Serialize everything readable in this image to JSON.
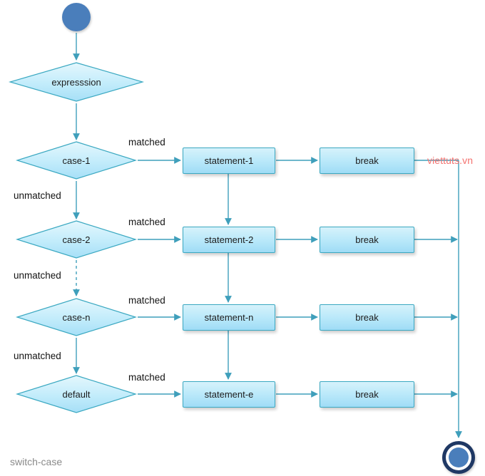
{
  "diagram": {
    "caption": "switch-case",
    "watermark": "viettuts.vn",
    "colors": {
      "edge": "#3f9fbb",
      "shape_fill_light": "#d6f2fb",
      "shape_fill_dark": "#9fdcf6",
      "shape_stroke": "#3aa8c1",
      "start_fill": "#4a7ebb",
      "end_ring": "#1f3864",
      "watermark": "#f4726f",
      "caption": "#8a8a8a",
      "text": "#1b1b1b"
    },
    "nodes": {
      "start": {
        "label": "",
        "icon": "start-node-icon"
      },
      "expression": {
        "label": "expresssion"
      },
      "case_1": {
        "label": "case-1"
      },
      "case_2": {
        "label": "case-2"
      },
      "case_n": {
        "label": "case-n"
      },
      "default": {
        "label": "default"
      },
      "statement_1": {
        "label": "statement-1"
      },
      "statement_2": {
        "label": "statement-2"
      },
      "statement_n": {
        "label": "statement-n"
      },
      "statement_e": {
        "label": "statement-e"
      },
      "break_1": {
        "label": "break"
      },
      "break_2": {
        "label": "break"
      },
      "break_n": {
        "label": "break"
      },
      "break_e": {
        "label": "break"
      },
      "end": {
        "label": "",
        "icon": "end-node-icon"
      }
    },
    "edge_labels": {
      "matched_1": "matched",
      "matched_2": "matched",
      "matched_n": "matched",
      "matched_e": "matched",
      "unmatched_1": "unmatched",
      "unmatched_2": "unmatched",
      "unmatched_n": "unmatched"
    }
  },
  "chart_data": {
    "type": "diagram",
    "title": "switch-case",
    "flow": [
      {
        "from": "start",
        "to": "expression",
        "label": ""
      },
      {
        "from": "expression",
        "to": "case-1",
        "label": ""
      },
      {
        "from": "case-1",
        "to": "statement-1",
        "label": "matched"
      },
      {
        "from": "case-1",
        "to": "case-2",
        "label": "unmatched"
      },
      {
        "from": "case-2",
        "to": "statement-2",
        "label": "matched"
      },
      {
        "from": "case-2",
        "to": "case-n",
        "label": "unmatched",
        "style": "dashed"
      },
      {
        "from": "case-n",
        "to": "statement-n",
        "label": "matched"
      },
      {
        "from": "case-n",
        "to": "default",
        "label": "unmatched"
      },
      {
        "from": "default",
        "to": "statement-e",
        "label": "matched"
      },
      {
        "from": "statement-1",
        "to": "break",
        "label": ""
      },
      {
        "from": "statement-1",
        "to": "statement-2",
        "label": ""
      },
      {
        "from": "statement-2",
        "to": "break",
        "label": ""
      },
      {
        "from": "statement-2",
        "to": "statement-n",
        "label": ""
      },
      {
        "from": "statement-n",
        "to": "break",
        "label": ""
      },
      {
        "from": "statement-n",
        "to": "statement-e",
        "label": ""
      },
      {
        "from": "statement-e",
        "to": "break",
        "label": ""
      },
      {
        "from": "break",
        "to": "end",
        "label": ""
      }
    ]
  }
}
